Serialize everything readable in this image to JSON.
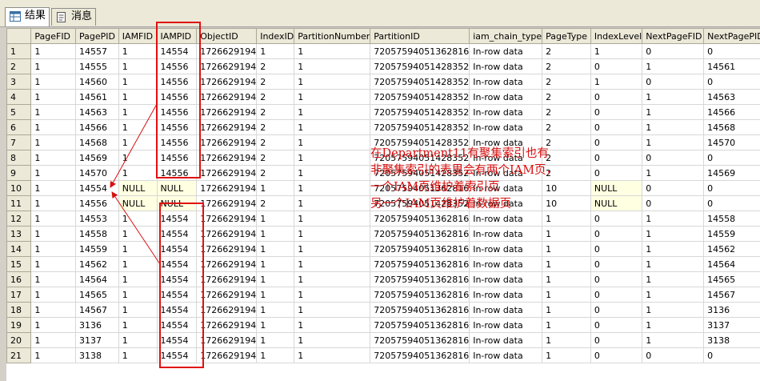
{
  "tabs": [
    {
      "label": "结果",
      "icon": "grid-icon"
    },
    {
      "label": "消息",
      "icon": "message-icon"
    }
  ],
  "columns": [
    "",
    "PageFID",
    "PagePID",
    "IAMFID",
    "IAMPID",
    "ObjectID",
    "IndexID",
    "PartitionNumber",
    "PartitionID",
    "iam_chain_type",
    "PageType",
    "IndexLevel",
    "NextPageFID",
    "NextPagePID"
  ],
  "rows": [
    [
      "1",
      "1",
      "14557",
      "1",
      "14554",
      "1726629194",
      "1",
      "1",
      "72057594051362816",
      "In-row data",
      "2",
      "1",
      "0",
      "0"
    ],
    [
      "2",
      "1",
      "14555",
      "1",
      "14556",
      "1726629194",
      "2",
      "1",
      "72057594051428352",
      "In-row data",
      "2",
      "0",
      "1",
      "14561"
    ],
    [
      "3",
      "1",
      "14560",
      "1",
      "14556",
      "1726629194",
      "2",
      "1",
      "72057594051428352",
      "In-row data",
      "2",
      "1",
      "0",
      "0"
    ],
    [
      "4",
      "1",
      "14561",
      "1",
      "14556",
      "1726629194",
      "2",
      "1",
      "72057594051428352",
      "In-row data",
      "2",
      "0",
      "1",
      "14563"
    ],
    [
      "5",
      "1",
      "14563",
      "1",
      "14556",
      "1726629194",
      "2",
      "1",
      "72057594051428352",
      "In-row data",
      "2",
      "0",
      "1",
      "14566"
    ],
    [
      "6",
      "1",
      "14566",
      "1",
      "14556",
      "1726629194",
      "2",
      "1",
      "72057594051428352",
      "In-row data",
      "2",
      "0",
      "1",
      "14568"
    ],
    [
      "7",
      "1",
      "14568",
      "1",
      "14556",
      "1726629194",
      "2",
      "1",
      "72057594051428352",
      "In-row data",
      "2",
      "0",
      "1",
      "14570"
    ],
    [
      "8",
      "1",
      "14569",
      "1",
      "14556",
      "1726629194",
      "2",
      "1",
      "72057594051428352",
      "In-row data",
      "2",
      "0",
      "0",
      "0"
    ],
    [
      "9",
      "1",
      "14570",
      "1",
      "14556",
      "1726629194",
      "2",
      "1",
      "72057594051428352",
      "In-row data",
      "2",
      "0",
      "1",
      "14569"
    ],
    [
      "10",
      "1",
      "14554",
      "NULL",
      "NULL",
      "1726629194",
      "1",
      "1",
      "72057594051362816",
      "In-row data",
      "10",
      "NULL",
      "0",
      "0"
    ],
    [
      "11",
      "1",
      "14556",
      "NULL",
      "NULL",
      "1726629194",
      "2",
      "1",
      "72057594051428352",
      "In-row data",
      "10",
      "NULL",
      "0",
      "0"
    ],
    [
      "12",
      "1",
      "14553",
      "1",
      "14554",
      "1726629194",
      "1",
      "1",
      "72057594051362816",
      "In-row data",
      "1",
      "0",
      "1",
      "14558"
    ],
    [
      "13",
      "1",
      "14558",
      "1",
      "14554",
      "1726629194",
      "1",
      "1",
      "72057594051362816",
      "In-row data",
      "1",
      "0",
      "1",
      "14559"
    ],
    [
      "14",
      "1",
      "14559",
      "1",
      "14554",
      "1726629194",
      "1",
      "1",
      "72057594051362816",
      "In-row data",
      "1",
      "0",
      "1",
      "14562"
    ],
    [
      "15",
      "1",
      "14562",
      "1",
      "14554",
      "1726629194",
      "1",
      "1",
      "72057594051362816",
      "In-row data",
      "1",
      "0",
      "1",
      "14564"
    ],
    [
      "16",
      "1",
      "14564",
      "1",
      "14554",
      "1726629194",
      "1",
      "1",
      "72057594051362816",
      "In-row data",
      "1",
      "0",
      "1",
      "14565"
    ],
    [
      "17",
      "1",
      "14565",
      "1",
      "14554",
      "1726629194",
      "1",
      "1",
      "72057594051362816",
      "In-row data",
      "1",
      "0",
      "1",
      "14567"
    ],
    [
      "18",
      "1",
      "14567",
      "1",
      "14554",
      "1726629194",
      "1",
      "1",
      "72057594051362816",
      "In-row data",
      "1",
      "0",
      "1",
      "3136"
    ],
    [
      "19",
      "1",
      "3136",
      "1",
      "14554",
      "1726629194",
      "1",
      "1",
      "72057594051362816",
      "In-row data",
      "1",
      "0",
      "1",
      "3137"
    ],
    [
      "20",
      "1",
      "3137",
      "1",
      "14554",
      "1726629194",
      "1",
      "1",
      "72057594051362816",
      "In-row data",
      "1",
      "0",
      "1",
      "3138"
    ],
    [
      "21",
      "1",
      "3138",
      "1",
      "14554",
      "1726629194",
      "1",
      "1",
      "72057594051362816",
      "In-row data",
      "1",
      "0",
      "0",
      "0"
    ]
  ],
  "annotations": [
    "在Department11有聚集索引也有",
    "非聚集索引的表里会有两个IAM页，",
    "一个IAM页维护着索引页",
    "另一个IAM页维护着数据页"
  ],
  "colors": {
    "annotation": "#d81010",
    "null_cell": "#ffffe1",
    "header": "#ece9d8"
  }
}
